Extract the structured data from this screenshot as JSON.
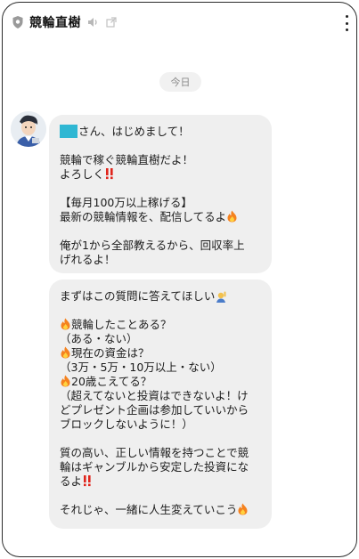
{
  "header": {
    "title": "競輪直樹",
    "shield_icon": "shield-icon",
    "mute_icon": "speaker-muted-icon",
    "external_icon": "external-link-icon",
    "menu_icon": "kebab-menu-icon"
  },
  "date_separator": "今日",
  "colors": {
    "bubble": "#efefef",
    "mention_highlight": "#2fb7d3",
    "fire": "#f5821f",
    "exclaim": "#e0241b"
  },
  "messages": [
    {
      "lines": {
        "l1": "さん、はじめまして！",
        "l2": "競輪で稼ぐ競輪直樹だよ！",
        "l3": "よろしく",
        "l4": "【毎月100万以上稼げる】",
        "l5": "最新の競輪情報を、配信してるよ",
        "l6": "俺が1から全部教えるから、回収率上",
        "l7": "げれるよ！"
      }
    },
    {
      "lines": {
        "l1": "まずはこの質問に答えてほしい",
        "l2": "競輪したことある？",
        "l3": "（ある・ない）",
        "l4": "現在の資金は？",
        "l5": "（3万・5万・10万以上・ない）",
        "l6": "20歳こえてる？",
        "l7": "（超えてないと投資はできないよ！け",
        "l8": "どプレゼント企画は参加していいから",
        "l9": "ブロックしないように！）",
        "l10": "質の高い、正しい情報を持つことで競",
        "l11": "輪はギャンブルから安定した投資にな",
        "l12": "るよ",
        "l13": "それじゃ、一緒に人生変えていこう"
      }
    }
  ]
}
